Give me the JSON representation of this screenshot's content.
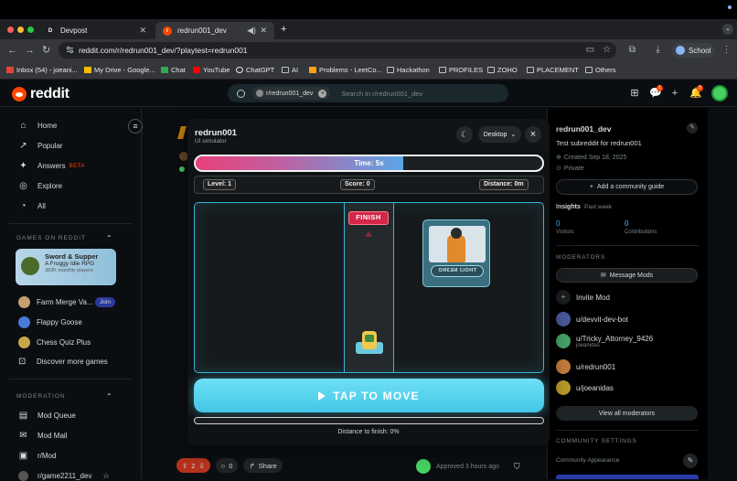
{
  "browser": {
    "tabs": [
      {
        "title": "Devpost",
        "icon": "D"
      },
      {
        "title": "redrun001_dev",
        "icon": "r"
      }
    ],
    "new_tab": "+",
    "url": "reddit.com/r/redrun001_dev/?playtest=redrun001",
    "profile": "School",
    "bookmarks": [
      "Inbox (54) - joeani...",
      "My Drive - Google...",
      "Chat",
      "YouTube",
      "ChatGPT",
      "AI",
      "Problems - LeetCo...",
      "Hackathon",
      "PROFILES",
      "ZOHO",
      "PLACEMENT",
      "Others"
    ]
  },
  "reddit": {
    "logo_text": "reddit",
    "search_chip": "r/redrun001_dev",
    "search_placeholder": "Search in r/redrun001_dev",
    "notif_badge_1": "1",
    "notif_badge_2": "3"
  },
  "leftnav": {
    "items": [
      "Home",
      "Popular",
      "Answers",
      "Explore",
      "All"
    ],
    "answers_badge": "BETA",
    "games_header": "GAMES ON REDDIT",
    "featured_game": {
      "title": "Sword & Supper",
      "subtitle": "A Froggy Idle RPG",
      "meta": "383K monthly players"
    },
    "games": [
      "Farm Merge Va...",
      "Flappy Goose",
      "Chess Quiz Plus",
      "Discover more games"
    ],
    "join_label": "Join",
    "moderation_header": "MODERATION",
    "mod_items": [
      "Mod Queue",
      "Mod Mail",
      "r/Mod",
      "r/game2211_dev"
    ]
  },
  "post": {
    "vote_count": "2",
    "comment_count": "0",
    "share_label": "Share",
    "approved_text": "Approved 3 hours ago"
  },
  "rightside": {
    "sub_name": "redrun001_dev",
    "description": "Test subreddit for redrun001",
    "created": "Created Sep 18, 2025",
    "privacy": "Private",
    "community_guide": "Add a community guide",
    "insights_label": "Insights",
    "insights_range": "Past week",
    "visitors_value": "0",
    "visitors_label": "Visitors",
    "contrib_value": "0",
    "contrib_label": "Contributions",
    "moderators_header": "MODERATORS",
    "message_mods": "Message Mods",
    "invite_mod": "Invite Mod",
    "mods": [
      {
        "name": "u/devvit-dev-bot",
        "sub": ""
      },
      {
        "name": "u/Tricky_Attorney_9426",
        "sub": "joeanidas"
      },
      {
        "name": "u/redrun001",
        "sub": ""
      },
      {
        "name": "u/joeanidas",
        "sub": ""
      }
    ],
    "view_all": "View all moderators",
    "settings_header": "COMMUNITY SETTINGS",
    "appearance": "Community Appearance"
  },
  "modal": {
    "title": "redrun001",
    "subtitle": "UI simulator",
    "device": "Desktop",
    "time_label": "Time: 5s",
    "time_fraction": 0.6,
    "level": "Level: 1",
    "score": "Score: 0",
    "distance": "Distance: 0m",
    "finish_label": "FINISH",
    "card_button": "THOIJ NE3RO",
    "tap_label": "TAP TO MOVE",
    "distance_progress": 0,
    "distance_label": "Distance to finish: 0%"
  },
  "colors": {
    "accent": "#ff4500",
    "cyan": "#38b5d6",
    "finish": "#d4284a"
  }
}
